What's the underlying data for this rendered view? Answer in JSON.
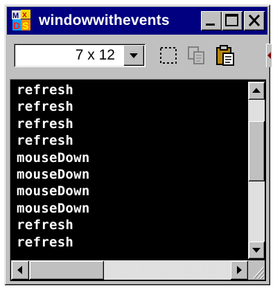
{
  "window": {
    "title": "windowwithevents",
    "app_icon": "director-cast-icon"
  },
  "titlebar_buttons": [
    {
      "name": "minimize-button",
      "icon": "minimize-icon"
    },
    {
      "name": "maximize-button",
      "icon": "maximize-icon"
    },
    {
      "name": "close-button",
      "icon": "close-icon"
    }
  ],
  "toolbar": {
    "font_size_select": {
      "value": "7 x 12"
    },
    "buttons": [
      {
        "name": "select-all-button",
        "icon": "marquee-select-icon"
      },
      {
        "name": "copy-button",
        "icon": "copy-icon"
      },
      {
        "name": "paste-button",
        "icon": "paste-icon"
      }
    ]
  },
  "console": {
    "lines": [
      "refresh",
      "refresh",
      "refresh",
      "refresh",
      "mouseDown",
      "mouseDown",
      "mouseDown",
      "mouseDown",
      "refresh",
      "refresh"
    ]
  },
  "colors": {
    "titlebar": "#000080",
    "face": "#c0c0c0",
    "console_bg": "#000000",
    "console_text": "#ffffff"
  }
}
